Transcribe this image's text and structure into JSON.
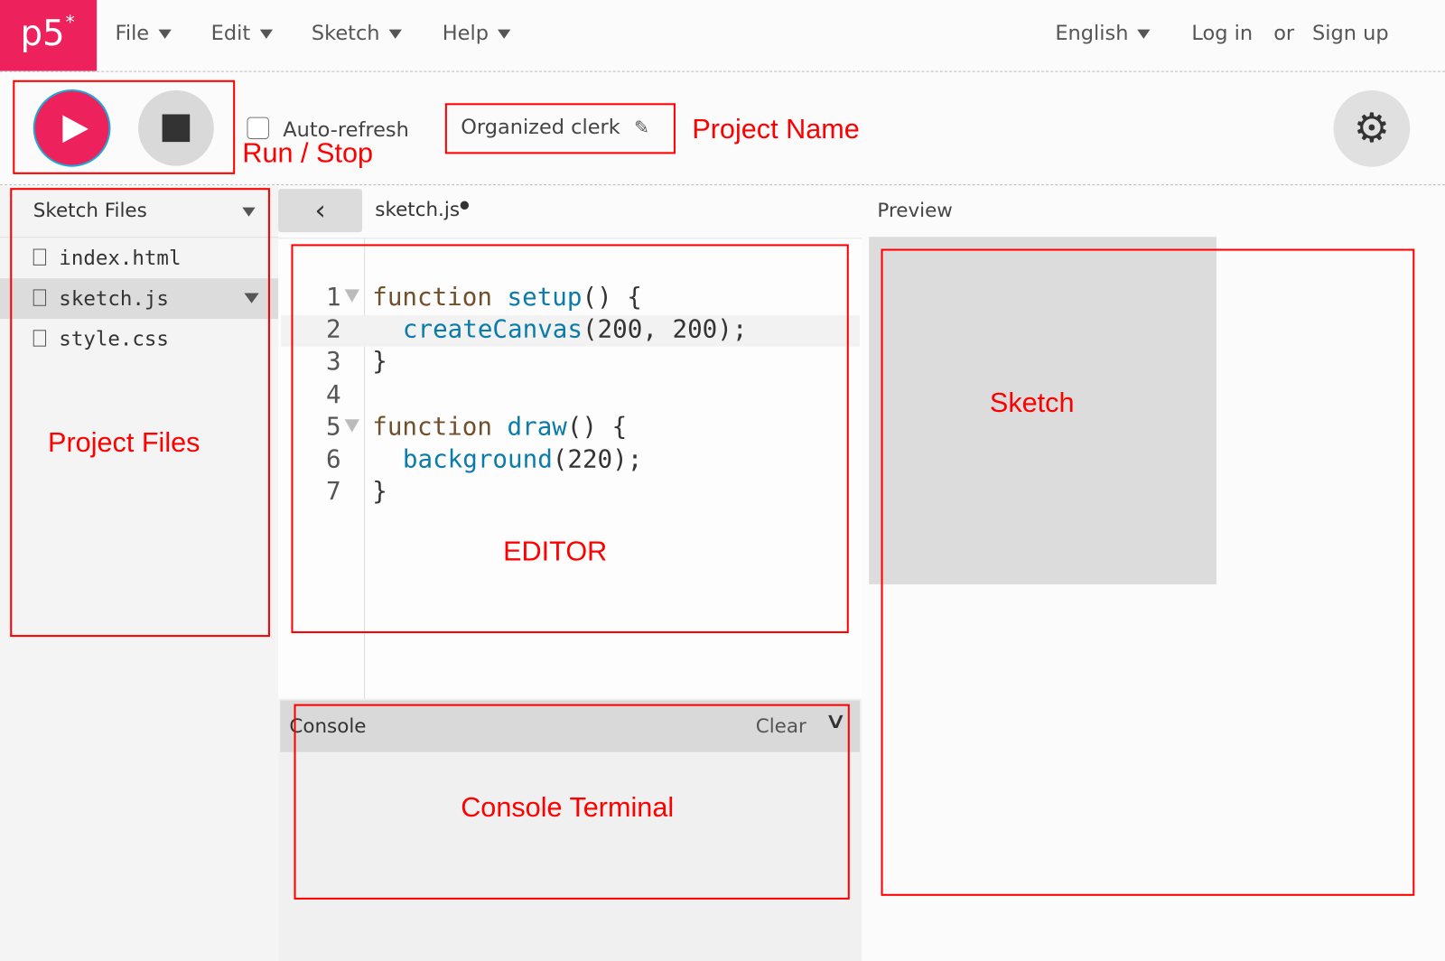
{
  "app": {
    "logo": "p5",
    "logo_star": "*"
  },
  "menu": [
    {
      "label": "File"
    },
    {
      "label": "Edit"
    },
    {
      "label": "Sketch"
    },
    {
      "label": "Help"
    }
  ],
  "right_nav": {
    "language": "English",
    "login": "Log in",
    "or": "or",
    "signup": "Sign up"
  },
  "toolbar": {
    "auto_refresh": "Auto-refresh",
    "auto_refresh_checked": false,
    "project_name": "Organized clerk"
  },
  "sidebar": {
    "title": "Sketch Files",
    "files": [
      {
        "name": "index.html"
      },
      {
        "name": "sketch.js",
        "selected": true
      },
      {
        "name": "style.css"
      }
    ]
  },
  "editor": {
    "tab": "sketch.js",
    "unsaved_dot": "●",
    "lines": [
      {
        "n": "1",
        "kw": "function ",
        "fn": "setup",
        "rest": "() {",
        "indent": false,
        "fold": true
      },
      {
        "n": "2",
        "kw": "",
        "fn": "createCanvas",
        "rest": "(200, 200);",
        "indent": true,
        "fold": false
      },
      {
        "n": "3",
        "kw": "",
        "fn": "",
        "rest": "}",
        "indent": false,
        "fold": false
      },
      {
        "n": "4",
        "kw": "",
        "fn": "",
        "rest": "",
        "indent": false,
        "fold": false
      },
      {
        "n": "5",
        "kw": "function ",
        "fn": "draw",
        "rest": "() {",
        "indent": false,
        "fold": true
      },
      {
        "n": "6",
        "kw": "",
        "fn": "background",
        "rest": "(220);",
        "indent": true,
        "fold": false
      },
      {
        "n": "7",
        "kw": "",
        "fn": "",
        "rest": "}",
        "indent": false,
        "fold": false
      }
    ]
  },
  "console": {
    "title": "Console",
    "clear": "Clear"
  },
  "preview": {
    "title": "Preview"
  },
  "annotations": {
    "run_stop": "Run / Stop",
    "project_name": "Project Name",
    "project_files": "Project Files",
    "editor": "EDITOR",
    "console": "Console Terminal",
    "sketch": "Sketch"
  },
  "colors": {
    "accent": "#ed225d",
    "annotation": "#ff0000",
    "keyword": "#704f2a",
    "function": "#0b7ca9"
  }
}
